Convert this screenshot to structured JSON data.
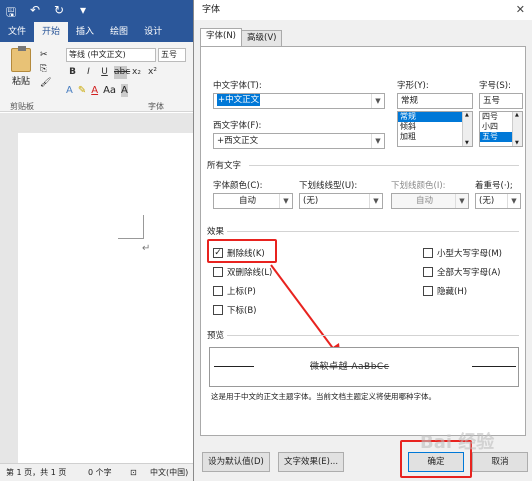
{
  "word": {
    "tabs": [
      "文件",
      "开始",
      "插入",
      "绘图",
      "设计"
    ],
    "active_tab": "开始",
    "paste_label": "粘贴",
    "font_name": "等线 (中文正文)",
    "font_size": "五号",
    "group_clipboard": "剪贴板",
    "group_font": "字体",
    "status": {
      "page": "第 1 页，共 1 页",
      "words": "0 个字",
      "lang": "中文(中国)"
    }
  },
  "dialog": {
    "title": "字体",
    "tabs": [
      "字体(N)",
      "高级(V)"
    ],
    "labels": {
      "chinese_font": "中文字体(T):",
      "western_font": "西文字体(F):",
      "style": "字形(Y):",
      "size": "字号(S):",
      "all_text": "所有文字",
      "font_color": "字体颜色(C):",
      "underline_type": "下划线线型(U):",
      "underline_color": "下划线颜色(I):",
      "emphasis": "着重号(·);",
      "effects": "效果",
      "preview": "预览"
    },
    "values": {
      "chinese_font": "+中文正文",
      "western_font": "+西文正文",
      "style": "常规",
      "style_list": [
        "常规",
        "倾斜",
        "加粗"
      ],
      "size": "五号",
      "size_list": [
        "四号",
        "小四",
        "五号"
      ],
      "font_color": "自动",
      "underline_type": "(无)",
      "underline_color": "自动",
      "emphasis": "(无)"
    },
    "effects_left": [
      {
        "label": "删除线(K)",
        "checked": true
      },
      {
        "label": "双删除线(L)",
        "checked": false
      },
      {
        "label": "上标(P)",
        "checked": false
      },
      {
        "label": "下标(B)",
        "checked": false
      }
    ],
    "effects_right": [
      {
        "label": "小型大写字母(M)",
        "checked": false
      },
      {
        "label": "全部大写字母(A)",
        "checked": false
      },
      {
        "label": "隐藏(H)",
        "checked": false
      }
    ],
    "preview_text": "微软卓越 AaBbCc",
    "note": "这是用于中文的正文主题字体。当前文档主题定义将使用哪种字体。",
    "buttons": {
      "set_default": "设为默认值(D)",
      "text_effects": "文字效果(E)...",
      "ok": "确定",
      "cancel": "取消"
    }
  },
  "watermark": "Bai 经验"
}
